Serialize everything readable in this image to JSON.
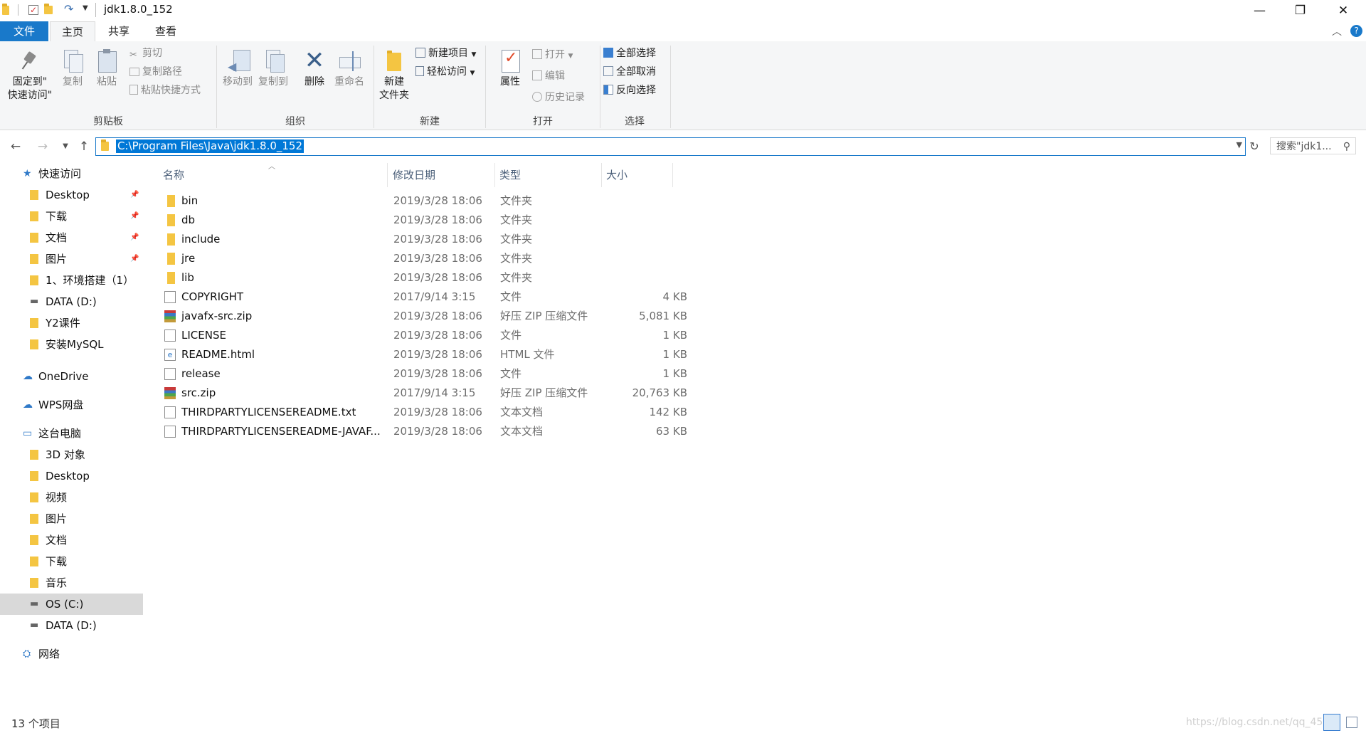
{
  "window": {
    "title": "jdk1.8.0_152",
    "minimize": "—",
    "restore": "❐",
    "close": "✕"
  },
  "tabs": [
    {
      "label": "文件"
    },
    {
      "label": "主页"
    },
    {
      "label": "共享"
    },
    {
      "label": "查看"
    }
  ],
  "ribbon": {
    "clipboard": {
      "label": "剪贴板",
      "pin_line1": "固定到\"",
      "pin_line2": "快速访问\"",
      "copy": "复制",
      "paste": "粘贴",
      "cut": "剪切",
      "copy_path": "复制路径",
      "paste_shortcut": "粘贴快捷方式"
    },
    "organize": {
      "label": "组织",
      "move_to": "移动到",
      "copy_to": "复制到",
      "delete": "删除",
      "rename": "重命名"
    },
    "new": {
      "label": "新建",
      "new_folder_line1": "新建",
      "new_folder_line2": "文件夹",
      "new_item": "新建项目",
      "easy_access": "轻松访问"
    },
    "open": {
      "label": "打开",
      "properties": "属性",
      "open": "打开",
      "edit": "编辑",
      "history": "历史记录"
    },
    "select": {
      "label": "选择",
      "select_all": "全部选择",
      "select_none": "全部取消",
      "invert": "反向选择"
    }
  },
  "address": {
    "path": "C:\\Program Files\\Java\\jdk1.8.0_152",
    "search_placeholder": "搜索\"jdk1..."
  },
  "nav": [
    {
      "label": "快速访问",
      "icon": "star-icon",
      "level": 0
    },
    {
      "label": "Desktop",
      "icon": "folder-icon",
      "level": 1,
      "pinned": true
    },
    {
      "label": "下载",
      "icon": "download-folder-icon",
      "level": 1,
      "pinned": true
    },
    {
      "label": "文档",
      "icon": "documents-folder-icon",
      "level": 1,
      "pinned": true
    },
    {
      "label": "图片",
      "icon": "pictures-folder-icon",
      "level": 1,
      "pinned": true
    },
    {
      "label": "1、环境搭建（1）",
      "icon": "folder-icon",
      "level": 1
    },
    {
      "label": "DATA (D:)",
      "icon": "drive-icon",
      "level": 1
    },
    {
      "label": "Y2课件",
      "icon": "folder-icon",
      "level": 1
    },
    {
      "label": "安装MySQL",
      "icon": "folder-icon",
      "level": 1
    },
    {
      "label": "OneDrive",
      "icon": "cloud-icon",
      "level": 0
    },
    {
      "label": "WPS网盘",
      "icon": "cloud-icon",
      "level": 0
    },
    {
      "label": "这台电脑",
      "icon": "computer-icon",
      "level": 0
    },
    {
      "label": "3D 对象",
      "icon": "3d-objects-icon",
      "level": 1
    },
    {
      "label": "Desktop",
      "icon": "folder-icon",
      "level": 1
    },
    {
      "label": "视频",
      "icon": "video-folder-icon",
      "level": 1
    },
    {
      "label": "图片",
      "icon": "pictures-folder-icon",
      "level": 1
    },
    {
      "label": "文档",
      "icon": "documents-folder-icon",
      "level": 1
    },
    {
      "label": "下载",
      "icon": "download-folder-icon",
      "level": 1
    },
    {
      "label": "音乐",
      "icon": "music-folder-icon",
      "level": 1
    },
    {
      "label": "OS (C:)",
      "icon": "drive-icon",
      "level": 1,
      "selected": true
    },
    {
      "label": "DATA (D:)",
      "icon": "drive-icon",
      "level": 1
    },
    {
      "label": "网络",
      "icon": "network-icon",
      "level": 0
    }
  ],
  "columns": {
    "name": "名称",
    "date": "修改日期",
    "type": "类型",
    "size": "大小"
  },
  "files": [
    {
      "name": "bin",
      "date": "2019/3/28 18:06",
      "type": "文件夹",
      "size": "",
      "icon": "folder-icon"
    },
    {
      "name": "db",
      "date": "2019/3/28 18:06",
      "type": "文件夹",
      "size": "",
      "icon": "folder-icon"
    },
    {
      "name": "include",
      "date": "2019/3/28 18:06",
      "type": "文件夹",
      "size": "",
      "icon": "folder-icon"
    },
    {
      "name": "jre",
      "date": "2019/3/28 18:06",
      "type": "文件夹",
      "size": "",
      "icon": "folder-icon"
    },
    {
      "name": "lib",
      "date": "2019/3/28 18:06",
      "type": "文件夹",
      "size": "",
      "icon": "folder-icon"
    },
    {
      "name": "COPYRIGHT",
      "date": "2017/9/14 3:15",
      "type": "文件",
      "size": "4 KB",
      "icon": "file-icon"
    },
    {
      "name": "javafx-src.zip",
      "date": "2019/3/28 18:06",
      "type": "好压 ZIP 压缩文件",
      "size": "5,081 KB",
      "icon": "zip-icon"
    },
    {
      "name": "LICENSE",
      "date": "2019/3/28 18:06",
      "type": "文件",
      "size": "1 KB",
      "icon": "file-icon"
    },
    {
      "name": "README.html",
      "date": "2019/3/28 18:06",
      "type": "HTML 文件",
      "size": "1 KB",
      "icon": "html-icon"
    },
    {
      "name": "release",
      "date": "2019/3/28 18:06",
      "type": "文件",
      "size": "1 KB",
      "icon": "file-icon"
    },
    {
      "name": "src.zip",
      "date": "2017/9/14 3:15",
      "type": "好压 ZIP 压缩文件",
      "size": "20,763 KB",
      "icon": "zip-icon"
    },
    {
      "name": "THIRDPARTYLICENSEREADME.txt",
      "date": "2019/3/28 18:06",
      "type": "文本文档",
      "size": "142 KB",
      "icon": "text-file-icon"
    },
    {
      "name": "THIRDPARTYLICENSEREADME-JAVAF...",
      "date": "2019/3/28 18:06",
      "type": "文本文档",
      "size": "63 KB",
      "icon": "text-file-icon"
    }
  ],
  "status": {
    "count": "13 个项目",
    "watermark": "https://blog.csdn.net/qq_45"
  },
  "colors": {
    "accent": "#1979ca",
    "selection": "#0078d7",
    "folder": "#f4c542"
  }
}
